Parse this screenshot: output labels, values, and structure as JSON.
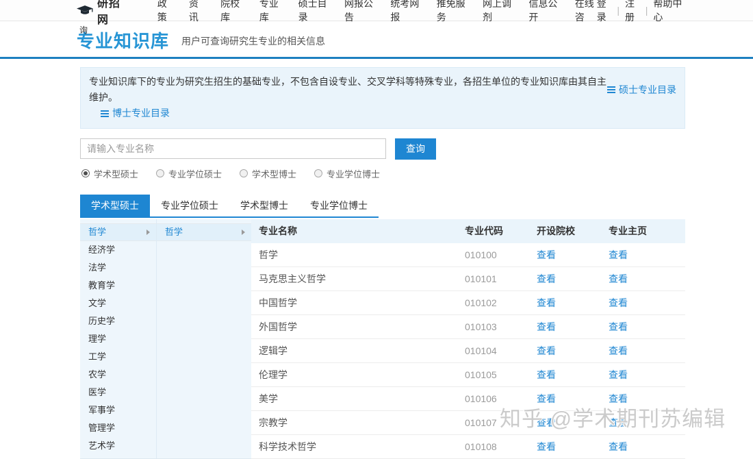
{
  "brand": {
    "name": "研招网"
  },
  "nav": {
    "items": [
      "政策",
      "资讯",
      "院校库",
      "专业库",
      "硕士目录",
      "网报公告",
      "统考网报",
      "推免服务",
      "网上调剂",
      "信息公开",
      "在线咨"
    ],
    "right": [
      "登录",
      "注册",
      "帮助中心"
    ]
  },
  "header": {
    "stray_char": "询",
    "title": "专业知识库",
    "subtitle": "用户可查询研究生专业的相关信息"
  },
  "notice": {
    "text": "专业知识库下的专业为研究生招生的基础专业，不包含自设专业、交叉学科等特殊专业，各招生单位的专业知识库由其自主维护。",
    "links": [
      {
        "label": "硕士专业目录"
      },
      {
        "label": "博士专业目录"
      }
    ]
  },
  "search": {
    "placeholder": "请输入专业名称",
    "button_label": "查询",
    "radios": [
      {
        "label": "学术型硕士",
        "checked": true
      },
      {
        "label": "专业学位硕士",
        "checked": false
      },
      {
        "label": "学术型博士",
        "checked": false
      },
      {
        "label": "专业学位博士",
        "checked": false
      }
    ]
  },
  "tabs": [
    {
      "label": "学术型硕士",
      "active": true
    },
    {
      "label": "专业学位硕士",
      "active": false
    },
    {
      "label": "学术型博士",
      "active": false
    },
    {
      "label": "专业学位博士",
      "active": false
    }
  ],
  "categories": [
    {
      "label": "哲学",
      "selected": true
    },
    {
      "label": "经济学",
      "selected": false
    },
    {
      "label": "法学",
      "selected": false
    },
    {
      "label": "教育学",
      "selected": false
    },
    {
      "label": "文学",
      "selected": false
    },
    {
      "label": "历史学",
      "selected": false
    },
    {
      "label": "理学",
      "selected": false
    },
    {
      "label": "工学",
      "selected": false
    },
    {
      "label": "农学",
      "selected": false
    },
    {
      "label": "医学",
      "selected": false
    },
    {
      "label": "军事学",
      "selected": false
    },
    {
      "label": "管理学",
      "selected": false
    },
    {
      "label": "艺术学",
      "selected": false
    }
  ],
  "subcategories": [
    {
      "label": "哲学",
      "selected": true
    }
  ],
  "table": {
    "headers": [
      "专业名称",
      "专业代码",
      "开设院校",
      "专业主页"
    ],
    "view_label": "查看",
    "rows": [
      {
        "name": "哲学",
        "code": "010100"
      },
      {
        "name": "马克思主义哲学",
        "code": "010101"
      },
      {
        "name": "中国哲学",
        "code": "010102"
      },
      {
        "name": "外国哲学",
        "code": "010103"
      },
      {
        "name": "逻辑学",
        "code": "010104"
      },
      {
        "name": "伦理学",
        "code": "010105"
      },
      {
        "name": "美学",
        "code": "010106"
      },
      {
        "name": "宗教学",
        "code": "010107"
      },
      {
        "name": "科学技术哲学",
        "code": "010108"
      }
    ]
  },
  "watermark": "知乎 @学术期刊苏编辑",
  "colors": {
    "accent": "#1e86d2",
    "title_blue": "#2795d5",
    "header_border": "#1d7fc0",
    "notice_bg": "#eaf4fb",
    "panel_bg": "#eef6fc",
    "thead_bg": "#eaf4fb"
  }
}
